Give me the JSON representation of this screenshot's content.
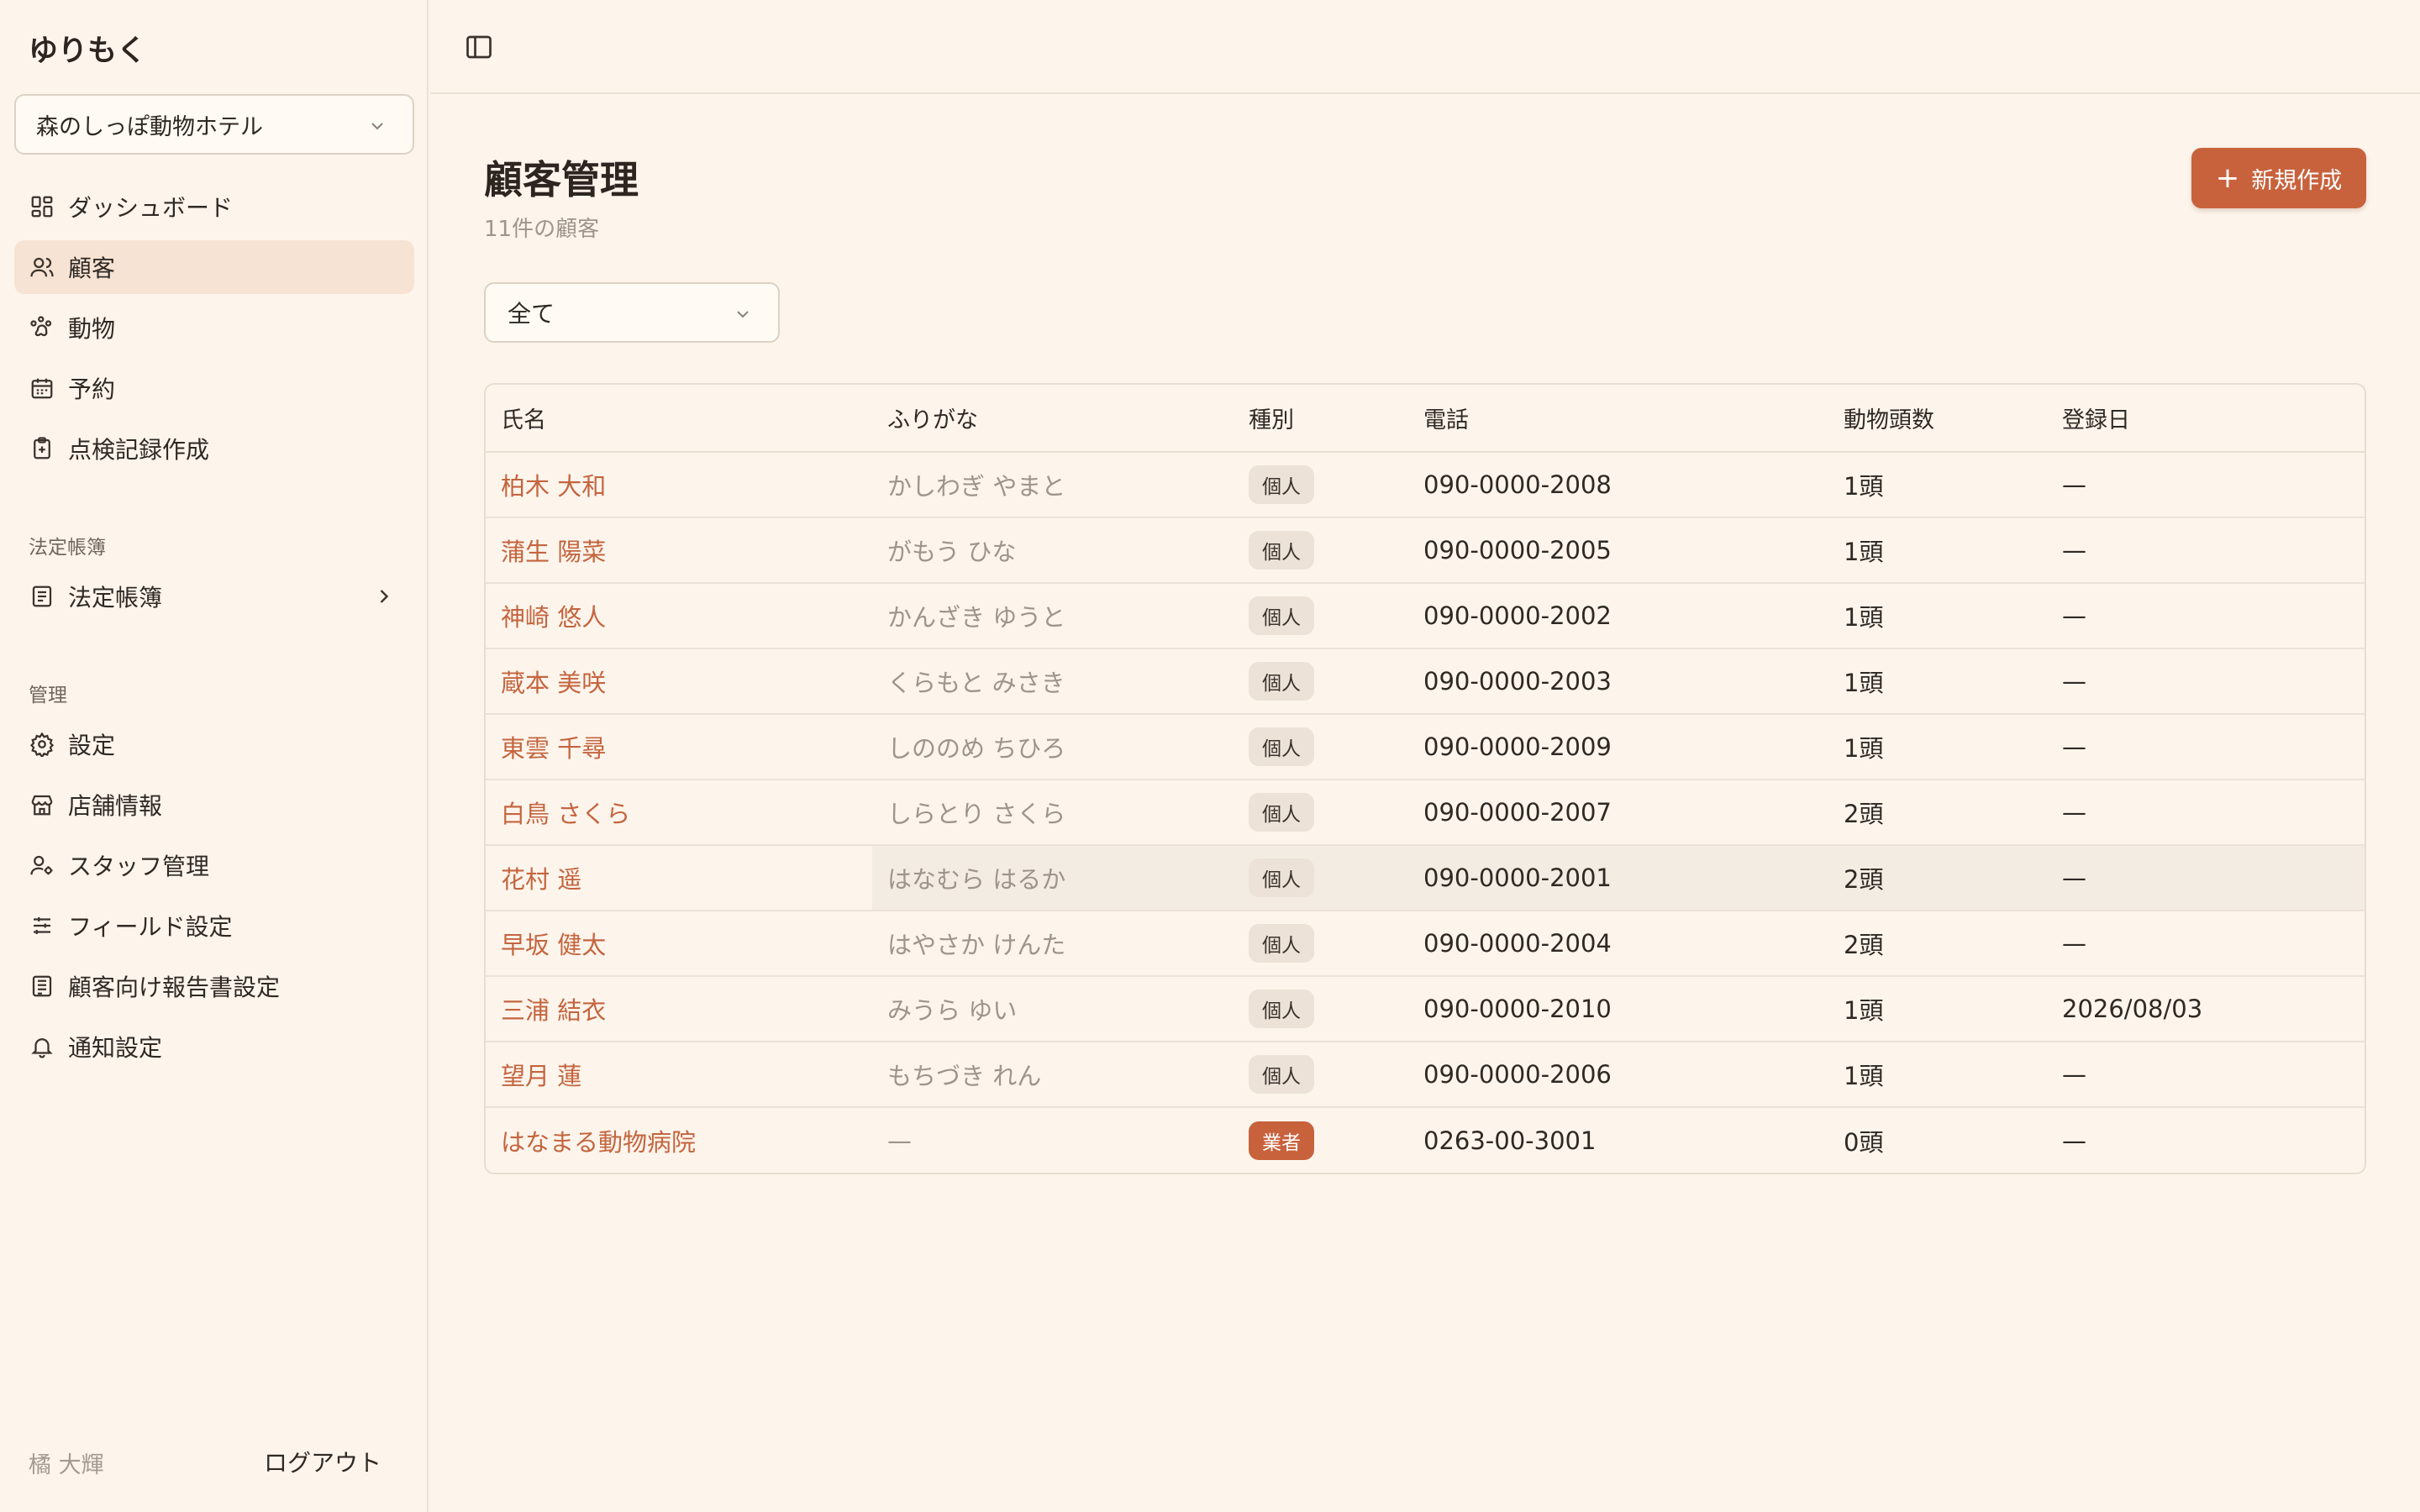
{
  "app": {
    "brand": "ゆりもく"
  },
  "sidebar": {
    "store": "森のしっぽ動物ホテル",
    "main_items": [
      {
        "label": "ダッシュボード",
        "icon": "dashboard-icon"
      },
      {
        "label": "顧客",
        "icon": "users-icon",
        "active": true
      },
      {
        "label": "動物",
        "icon": "paw-icon"
      },
      {
        "label": "予約",
        "icon": "calendar-icon"
      },
      {
        "label": "点検記録作成",
        "icon": "clipboard-plus-icon"
      }
    ],
    "ledger_section": "法定帳簿",
    "ledger_item": "法定帳簿",
    "admin_section": "管理",
    "admin_items": [
      {
        "label": "設定",
        "icon": "gear-icon"
      },
      {
        "label": "店舗情報",
        "icon": "store-icon"
      },
      {
        "label": "スタッフ管理",
        "icon": "staff-icon"
      },
      {
        "label": "フィールド設定",
        "icon": "sliders-icon"
      },
      {
        "label": "顧客向け報告書設定",
        "icon": "report-icon"
      },
      {
        "label": "通知設定",
        "icon": "bell-icon"
      }
    ],
    "user_name": "橘 大輝",
    "logout": "ログアウト"
  },
  "main": {
    "title": "顧客管理",
    "subtitle": "11件の顧客",
    "new_button": "新規作成",
    "filter": "全て",
    "columns": [
      "氏名",
      "ふりがな",
      "種別",
      "電話",
      "動物頭数",
      "登録日"
    ],
    "rows": [
      {
        "name": "柏木 大和",
        "kana": "かしわぎ やまと",
        "type": "個人",
        "phone": "090-0000-2008",
        "animals": "1頭",
        "date": "—"
      },
      {
        "name": "蒲生 陽菜",
        "kana": "がもう ひな",
        "type": "個人",
        "phone": "090-0000-2005",
        "animals": "1頭",
        "date": "—"
      },
      {
        "name": "神崎 悠人",
        "kana": "かんざき ゆうと",
        "type": "個人",
        "phone": "090-0000-2002",
        "animals": "1頭",
        "date": "—"
      },
      {
        "name": "蔵本 美咲",
        "kana": "くらもと みさき",
        "type": "個人",
        "phone": "090-0000-2003",
        "animals": "1頭",
        "date": "—"
      },
      {
        "name": "東雲 千尋",
        "kana": "しののめ ちひろ",
        "type": "個人",
        "phone": "090-0000-2009",
        "animals": "1頭",
        "date": "—"
      },
      {
        "name": "白鳥 さくら",
        "kana": "しらとり さくら",
        "type": "個人",
        "phone": "090-0000-2007",
        "animals": "2頭",
        "date": "—"
      },
      {
        "name": "花村 遥",
        "kana": "はなむら はるか",
        "type": "個人",
        "phone": "090-0000-2001",
        "animals": "2頭",
        "date": "—"
      },
      {
        "name": "早坂 健太",
        "kana": "はやさか けんた",
        "type": "個人",
        "phone": "090-0000-2004",
        "animals": "2頭",
        "date": "—"
      },
      {
        "name": "三浦 結衣",
        "kana": "みうら ゆい",
        "type": "個人",
        "phone": "090-0000-2010",
        "animals": "1頭",
        "date": "2026/08/03"
      },
      {
        "name": "望月 蓮",
        "kana": "もちづき れん",
        "type": "個人",
        "phone": "090-0000-2006",
        "animals": "1頭",
        "date": "—"
      },
      {
        "name": "はなまる動物病院",
        "kana": "—",
        "type": "業者",
        "phone": "0263-00-3001",
        "animals": "0頭",
        "date": "—"
      }
    ]
  },
  "colors": {
    "accent": "#c8623d",
    "background": "#fdf5ec",
    "active_nav": "#f6e3d3"
  }
}
